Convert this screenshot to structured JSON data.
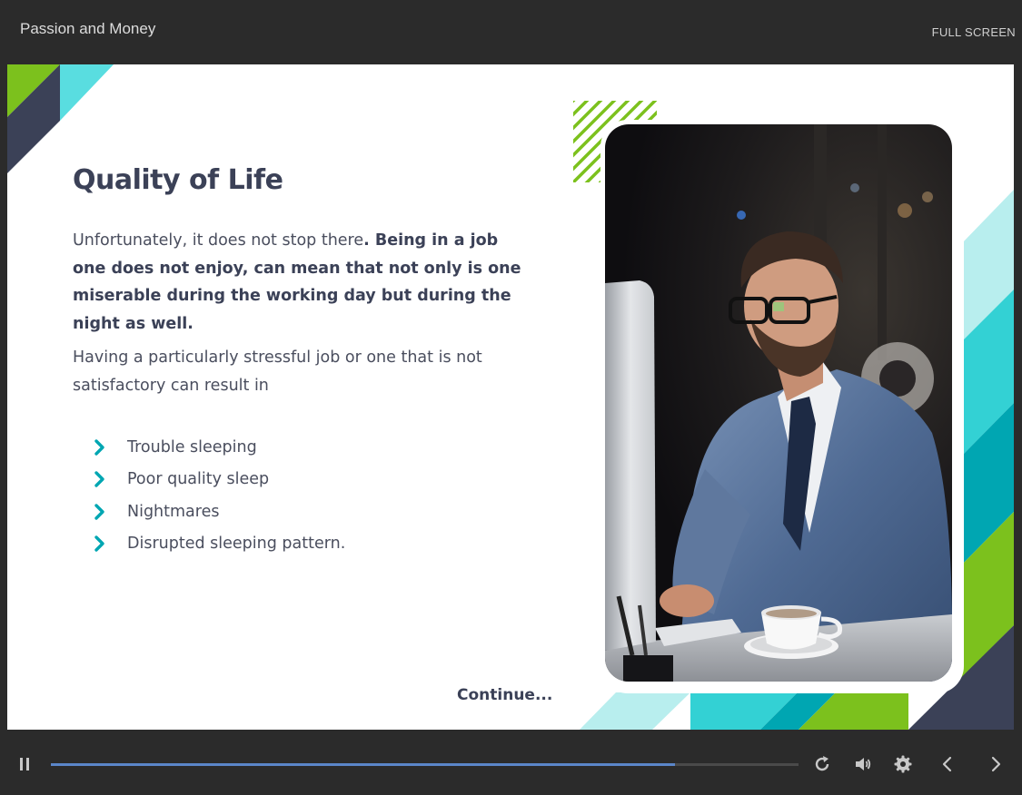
{
  "topbar": {
    "course_title": "Passion and Money",
    "fullscreen_label": "FULL SCREEN"
  },
  "slide": {
    "title": "Quality of Life",
    "para1_normal": "Unfortunately, it does not stop there",
    "para1_bold": ". Being in a job one does not enjoy, can mean that not only is one miserable during the working day but during the night as well.",
    "para2": "Having a particularly stressful job or one that is not satisfactory can result in",
    "bullets": [
      "Trouble sleeping",
      "Poor quality sleep",
      "Nightmares",
      "Disrupted sleeping pattern."
    ],
    "continue_label": "Continue..."
  },
  "photo": {
    "alt": "Man in suit working at a computer at night"
  },
  "player": {
    "progress_fraction": 0.835,
    "icons": [
      "pause-icon",
      "replay-icon",
      "volume-icon",
      "gear-icon",
      "chevron-left-icon",
      "chevron-right-icon"
    ]
  },
  "colors": {
    "navy": "#3b4157",
    "teal": "#00a6b2",
    "cyan": "#33d1d4",
    "light_cyan": "#b8eeee",
    "lime": "#7cc11d",
    "progress": "#5b86c9",
    "bar_bg": "#2b2b2b"
  }
}
